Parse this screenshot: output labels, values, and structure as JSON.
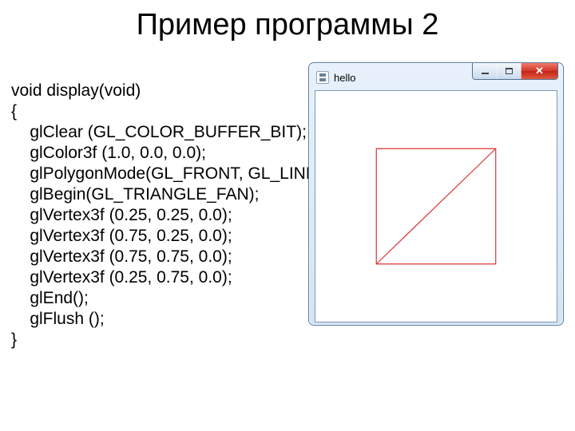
{
  "title": "Пример программы 2",
  "code": "void display(void)\n{\n    glClear (GL_COLOR_BUFFER_BIT);\n    glColor3f (1.0, 0.0, 0.0);\n    glPolygonMode(GL_FRONT, GL_LINE);\n    glBegin(GL_TRIANGLE_FAN);\n    glVertex3f (0.25, 0.25, 0.0);\n    glVertex3f (0.75, 0.25, 0.0);\n    glVertex3f (0.75, 0.75, 0.0);\n    glVertex3f (0.25, 0.75, 0.0);\n    glEnd();\n    glFlush ();\n}",
  "window": {
    "title": "hello"
  },
  "gl": {
    "clear_color": "white",
    "draw_color_rgb": [
      1.0,
      0.0,
      0.0
    ],
    "polygon_mode": {
      "face": "GL_FRONT",
      "mode": "GL_LINE"
    },
    "primitive": "GL_TRIANGLE_FAN",
    "vertices": [
      [
        0.25,
        0.25,
        0.0
      ],
      [
        0.75,
        0.25,
        0.0
      ],
      [
        0.75,
        0.75,
        0.0
      ],
      [
        0.25,
        0.75,
        0.0
      ]
    ]
  }
}
